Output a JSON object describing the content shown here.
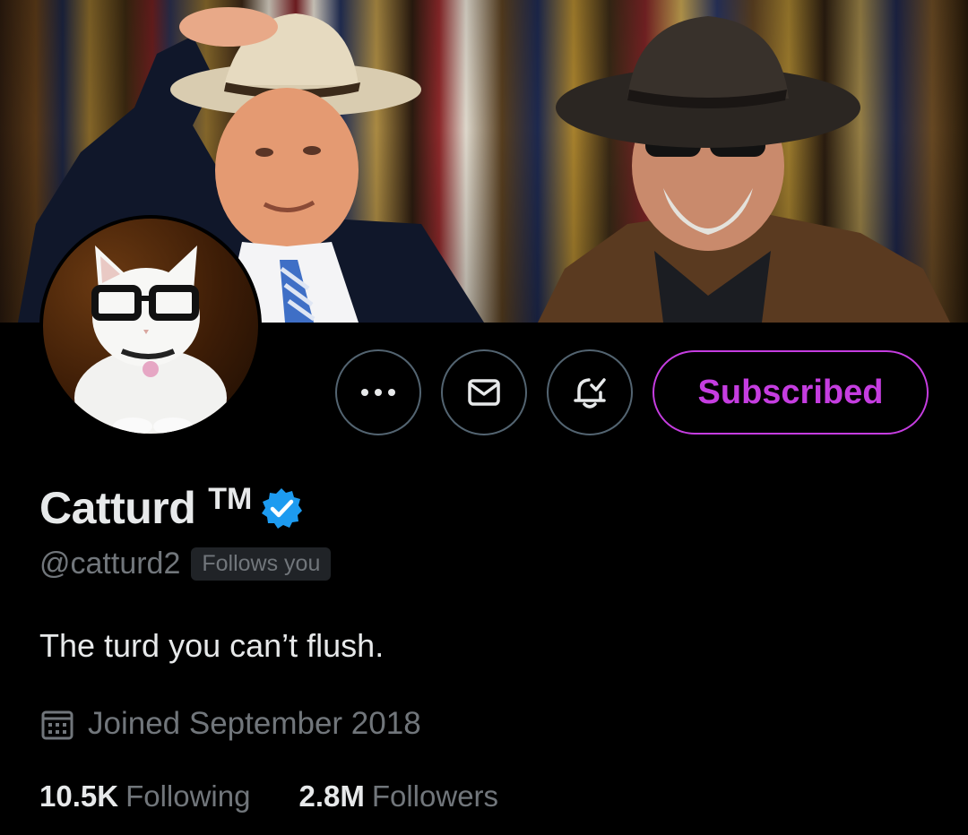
{
  "profile": {
    "display_name": "Catturd",
    "trademark": "TM",
    "handle": "@catturd2",
    "follows_you": "Follows you",
    "bio": "The turd you can’t flush.",
    "joined": "Joined September 2018",
    "stats": {
      "following_count": "10.5K",
      "following_label": "Following",
      "followers_count": "2.8M",
      "followers_label": "Followers"
    }
  },
  "actions": {
    "more_icon": "more-horizontal-icon",
    "message_icon": "envelope-icon",
    "notify_icon": "bell-check-icon",
    "subscribed_label": "Subscribed"
  },
  "colors": {
    "background": "#000000",
    "primary_text": "#e7e9ea",
    "secondary_text": "#71767b",
    "border": "#536471",
    "subscribed_accent": "#c53de0",
    "verified_blue": "#1d9bf0",
    "badge_bg": "#202327"
  }
}
